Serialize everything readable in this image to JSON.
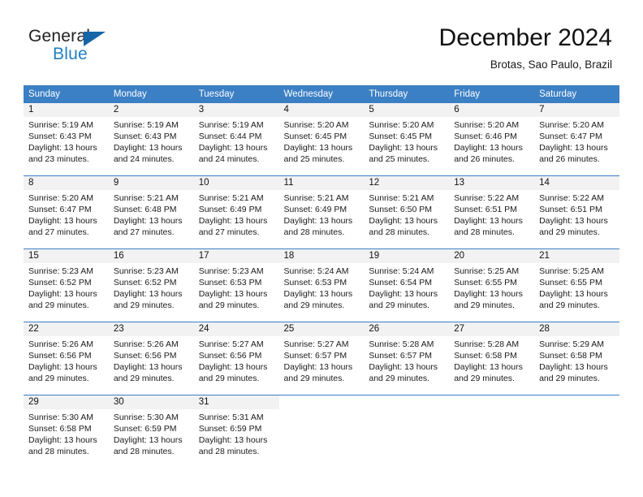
{
  "brand": {
    "name_part1": "General",
    "name_part2": "Blue",
    "triangle_icon": "triangle-icon",
    "color_dark": "#222222",
    "color_blue": "#1f7fc4"
  },
  "header": {
    "title": "December 2024",
    "subtitle": "Brotas, Sao Paulo, Brazil"
  },
  "calendar": {
    "header_bg": "#3b7fc4",
    "daynum_bg": "#f2f2f2",
    "weekdays": [
      "Sunday",
      "Monday",
      "Tuesday",
      "Wednesday",
      "Thursday",
      "Friday",
      "Saturday"
    ],
    "weeks": [
      [
        {
          "day": "1",
          "sunrise": "Sunrise: 5:19 AM",
          "sunset": "Sunset: 6:43 PM",
          "daylight_line1": "Daylight: 13 hours",
          "daylight_line2": "and 23 minutes."
        },
        {
          "day": "2",
          "sunrise": "Sunrise: 5:19 AM",
          "sunset": "Sunset: 6:43 PM",
          "daylight_line1": "Daylight: 13 hours",
          "daylight_line2": "and 24 minutes."
        },
        {
          "day": "3",
          "sunrise": "Sunrise: 5:19 AM",
          "sunset": "Sunset: 6:44 PM",
          "daylight_line1": "Daylight: 13 hours",
          "daylight_line2": "and 24 minutes."
        },
        {
          "day": "4",
          "sunrise": "Sunrise: 5:20 AM",
          "sunset": "Sunset: 6:45 PM",
          "daylight_line1": "Daylight: 13 hours",
          "daylight_line2": "and 25 minutes."
        },
        {
          "day": "5",
          "sunrise": "Sunrise: 5:20 AM",
          "sunset": "Sunset: 6:45 PM",
          "daylight_line1": "Daylight: 13 hours",
          "daylight_line2": "and 25 minutes."
        },
        {
          "day": "6",
          "sunrise": "Sunrise: 5:20 AM",
          "sunset": "Sunset: 6:46 PM",
          "daylight_line1": "Daylight: 13 hours",
          "daylight_line2": "and 26 minutes."
        },
        {
          "day": "7",
          "sunrise": "Sunrise: 5:20 AM",
          "sunset": "Sunset: 6:47 PM",
          "daylight_line1": "Daylight: 13 hours",
          "daylight_line2": "and 26 minutes."
        }
      ],
      [
        {
          "day": "8",
          "sunrise": "Sunrise: 5:20 AM",
          "sunset": "Sunset: 6:47 PM",
          "daylight_line1": "Daylight: 13 hours",
          "daylight_line2": "and 27 minutes."
        },
        {
          "day": "9",
          "sunrise": "Sunrise: 5:21 AM",
          "sunset": "Sunset: 6:48 PM",
          "daylight_line1": "Daylight: 13 hours",
          "daylight_line2": "and 27 minutes."
        },
        {
          "day": "10",
          "sunrise": "Sunrise: 5:21 AM",
          "sunset": "Sunset: 6:49 PM",
          "daylight_line1": "Daylight: 13 hours",
          "daylight_line2": "and 27 minutes."
        },
        {
          "day": "11",
          "sunrise": "Sunrise: 5:21 AM",
          "sunset": "Sunset: 6:49 PM",
          "daylight_line1": "Daylight: 13 hours",
          "daylight_line2": "and 28 minutes."
        },
        {
          "day": "12",
          "sunrise": "Sunrise: 5:21 AM",
          "sunset": "Sunset: 6:50 PM",
          "daylight_line1": "Daylight: 13 hours",
          "daylight_line2": "and 28 minutes."
        },
        {
          "day": "13",
          "sunrise": "Sunrise: 5:22 AM",
          "sunset": "Sunset: 6:51 PM",
          "daylight_line1": "Daylight: 13 hours",
          "daylight_line2": "and 28 minutes."
        },
        {
          "day": "14",
          "sunrise": "Sunrise: 5:22 AM",
          "sunset": "Sunset: 6:51 PM",
          "daylight_line1": "Daylight: 13 hours",
          "daylight_line2": "and 29 minutes."
        }
      ],
      [
        {
          "day": "15",
          "sunrise": "Sunrise: 5:23 AM",
          "sunset": "Sunset: 6:52 PM",
          "daylight_line1": "Daylight: 13 hours",
          "daylight_line2": "and 29 minutes."
        },
        {
          "day": "16",
          "sunrise": "Sunrise: 5:23 AM",
          "sunset": "Sunset: 6:52 PM",
          "daylight_line1": "Daylight: 13 hours",
          "daylight_line2": "and 29 minutes."
        },
        {
          "day": "17",
          "sunrise": "Sunrise: 5:23 AM",
          "sunset": "Sunset: 6:53 PM",
          "daylight_line1": "Daylight: 13 hours",
          "daylight_line2": "and 29 minutes."
        },
        {
          "day": "18",
          "sunrise": "Sunrise: 5:24 AM",
          "sunset": "Sunset: 6:53 PM",
          "daylight_line1": "Daylight: 13 hours",
          "daylight_line2": "and 29 minutes."
        },
        {
          "day": "19",
          "sunrise": "Sunrise: 5:24 AM",
          "sunset": "Sunset: 6:54 PM",
          "daylight_line1": "Daylight: 13 hours",
          "daylight_line2": "and 29 minutes."
        },
        {
          "day": "20",
          "sunrise": "Sunrise: 5:25 AM",
          "sunset": "Sunset: 6:55 PM",
          "daylight_line1": "Daylight: 13 hours",
          "daylight_line2": "and 29 minutes."
        },
        {
          "day": "21",
          "sunrise": "Sunrise: 5:25 AM",
          "sunset": "Sunset: 6:55 PM",
          "daylight_line1": "Daylight: 13 hours",
          "daylight_line2": "and 29 minutes."
        }
      ],
      [
        {
          "day": "22",
          "sunrise": "Sunrise: 5:26 AM",
          "sunset": "Sunset: 6:56 PM",
          "daylight_line1": "Daylight: 13 hours",
          "daylight_line2": "and 29 minutes."
        },
        {
          "day": "23",
          "sunrise": "Sunrise: 5:26 AM",
          "sunset": "Sunset: 6:56 PM",
          "daylight_line1": "Daylight: 13 hours",
          "daylight_line2": "and 29 minutes."
        },
        {
          "day": "24",
          "sunrise": "Sunrise: 5:27 AM",
          "sunset": "Sunset: 6:56 PM",
          "daylight_line1": "Daylight: 13 hours",
          "daylight_line2": "and 29 minutes."
        },
        {
          "day": "25",
          "sunrise": "Sunrise: 5:27 AM",
          "sunset": "Sunset: 6:57 PM",
          "daylight_line1": "Daylight: 13 hours",
          "daylight_line2": "and 29 minutes."
        },
        {
          "day": "26",
          "sunrise": "Sunrise: 5:28 AM",
          "sunset": "Sunset: 6:57 PM",
          "daylight_line1": "Daylight: 13 hours",
          "daylight_line2": "and 29 minutes."
        },
        {
          "day": "27",
          "sunrise": "Sunrise: 5:28 AM",
          "sunset": "Sunset: 6:58 PM",
          "daylight_line1": "Daylight: 13 hours",
          "daylight_line2": "and 29 minutes."
        },
        {
          "day": "28",
          "sunrise": "Sunrise: 5:29 AM",
          "sunset": "Sunset: 6:58 PM",
          "daylight_line1": "Daylight: 13 hours",
          "daylight_line2": "and 29 minutes."
        }
      ],
      [
        {
          "day": "29",
          "sunrise": "Sunrise: 5:30 AM",
          "sunset": "Sunset: 6:58 PM",
          "daylight_line1": "Daylight: 13 hours",
          "daylight_line2": "and 28 minutes."
        },
        {
          "day": "30",
          "sunrise": "Sunrise: 5:30 AM",
          "sunset": "Sunset: 6:59 PM",
          "daylight_line1": "Daylight: 13 hours",
          "daylight_line2": "and 28 minutes."
        },
        {
          "day": "31",
          "sunrise": "Sunrise: 5:31 AM",
          "sunset": "Sunset: 6:59 PM",
          "daylight_line1": "Daylight: 13 hours",
          "daylight_line2": "and 28 minutes."
        },
        {
          "day": "",
          "sunrise": "",
          "sunset": "",
          "daylight_line1": "",
          "daylight_line2": ""
        },
        {
          "day": "",
          "sunrise": "",
          "sunset": "",
          "daylight_line1": "",
          "daylight_line2": ""
        },
        {
          "day": "",
          "sunrise": "",
          "sunset": "",
          "daylight_line1": "",
          "daylight_line2": ""
        },
        {
          "day": "",
          "sunrise": "",
          "sunset": "",
          "daylight_line1": "",
          "daylight_line2": ""
        }
      ]
    ]
  }
}
